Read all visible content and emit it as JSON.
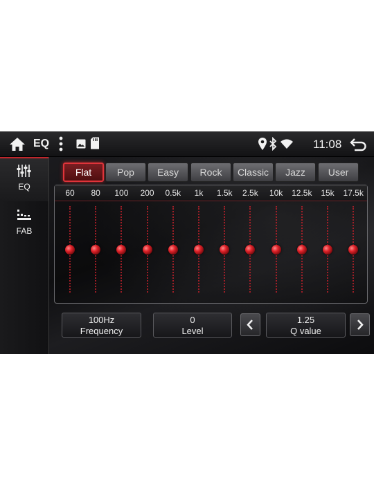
{
  "status_bar": {
    "app_title": "EQ",
    "clock": "11:08",
    "icons": [
      "home-icon",
      "menu-icon",
      "gallery-icon",
      "sd-card-icon",
      "location-icon",
      "bluetooth-icon",
      "wifi-icon",
      "back-icon"
    ]
  },
  "sidebar": {
    "items": [
      {
        "label": "EQ",
        "icon": "equalizer-sliders-icon",
        "active": true
      },
      {
        "label": "FAB",
        "icon": "fader-balance-icon",
        "active": false
      }
    ]
  },
  "presets": [
    {
      "label": "Flat",
      "active": true
    },
    {
      "label": "Pop",
      "active": false
    },
    {
      "label": "Easy",
      "active": false
    },
    {
      "label": "Rock",
      "active": false
    },
    {
      "label": "Classic",
      "active": false
    },
    {
      "label": "Jazz",
      "active": false
    },
    {
      "label": "User",
      "active": false
    }
  ],
  "bands": [
    {
      "freq": "60",
      "level": 0
    },
    {
      "freq": "80",
      "level": 0
    },
    {
      "freq": "100",
      "level": 0
    },
    {
      "freq": "200",
      "level": 0
    },
    {
      "freq": "0.5k",
      "level": 0
    },
    {
      "freq": "1k",
      "level": 0
    },
    {
      "freq": "1.5k",
      "level": 0
    },
    {
      "freq": "2.5k",
      "level": 0
    },
    {
      "freq": "10k",
      "level": 0
    },
    {
      "freq": "12.5k",
      "level": 0
    },
    {
      "freq": "15k",
      "level": 0
    },
    {
      "freq": "17.5k",
      "level": 0
    }
  ],
  "controls": {
    "frequency": {
      "value": "100Hz",
      "label": "Frequency"
    },
    "level": {
      "value": "0",
      "label": "Level"
    },
    "q_value": {
      "value": "1.25",
      "label": "Q value"
    }
  },
  "colors": {
    "accent": "#e0232a",
    "background": "#0d0d0f"
  }
}
